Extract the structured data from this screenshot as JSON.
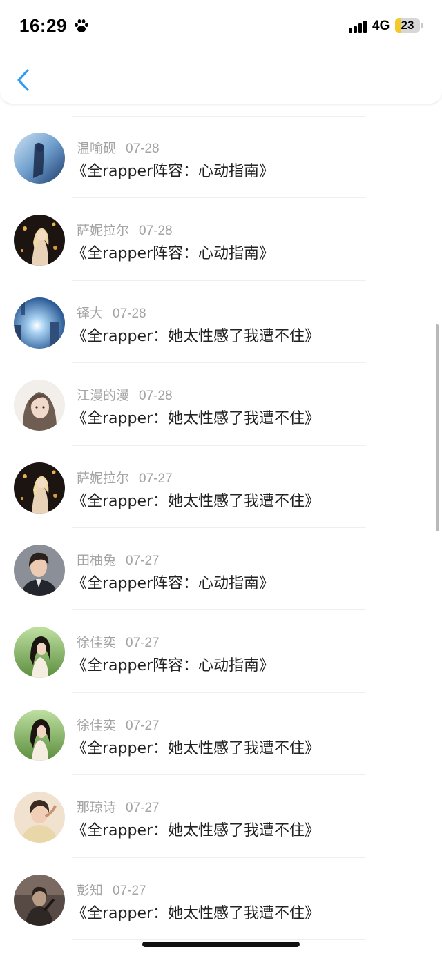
{
  "status_bar": {
    "time": "16:29",
    "network": "4G",
    "battery": "23",
    "battery_level": 0.23
  },
  "icons": {
    "back": "chevron-left-icon",
    "paw": "paw-icon",
    "signal": "cellular-signal-icon"
  },
  "colors": {
    "accent": "#2f9df4",
    "name_gray": "#a3a3a3",
    "title_text": "#222222"
  },
  "list": [
    {
      "name": "温喻砚",
      "date": "07-28",
      "title": "《全rapper阵容：心动指南》"
    },
    {
      "name": "萨妮拉尔",
      "date": "07-28",
      "title": "《全rapper阵容：心动指南》"
    },
    {
      "name": "铎大",
      "date": "07-28",
      "title": "《全rapper：她太性感了我遭不住》"
    },
    {
      "name": "江漫的漫",
      "date": "07-28",
      "title": "《全rapper：她太性感了我遭不住》"
    },
    {
      "name": "萨妮拉尔",
      "date": "07-27",
      "title": "《全rapper：她太性感了我遭不住》"
    },
    {
      "name": "田柚兔",
      "date": "07-27",
      "title": "《全rapper阵容：心动指南》"
    },
    {
      "name": "徐佳奕",
      "date": "07-27",
      "title": "《全rapper阵容：心动指南》"
    },
    {
      "name": "徐佳奕",
      "date": "07-27",
      "title": "《全rapper：她太性感了我遭不住》"
    },
    {
      "name": "那琼诗",
      "date": "07-27",
      "title": "《全rapper：她太性感了我遭不住》"
    },
    {
      "name": "彭知",
      "date": "07-27",
      "title": "《全rapper：她太性感了我遭不住》"
    }
  ]
}
